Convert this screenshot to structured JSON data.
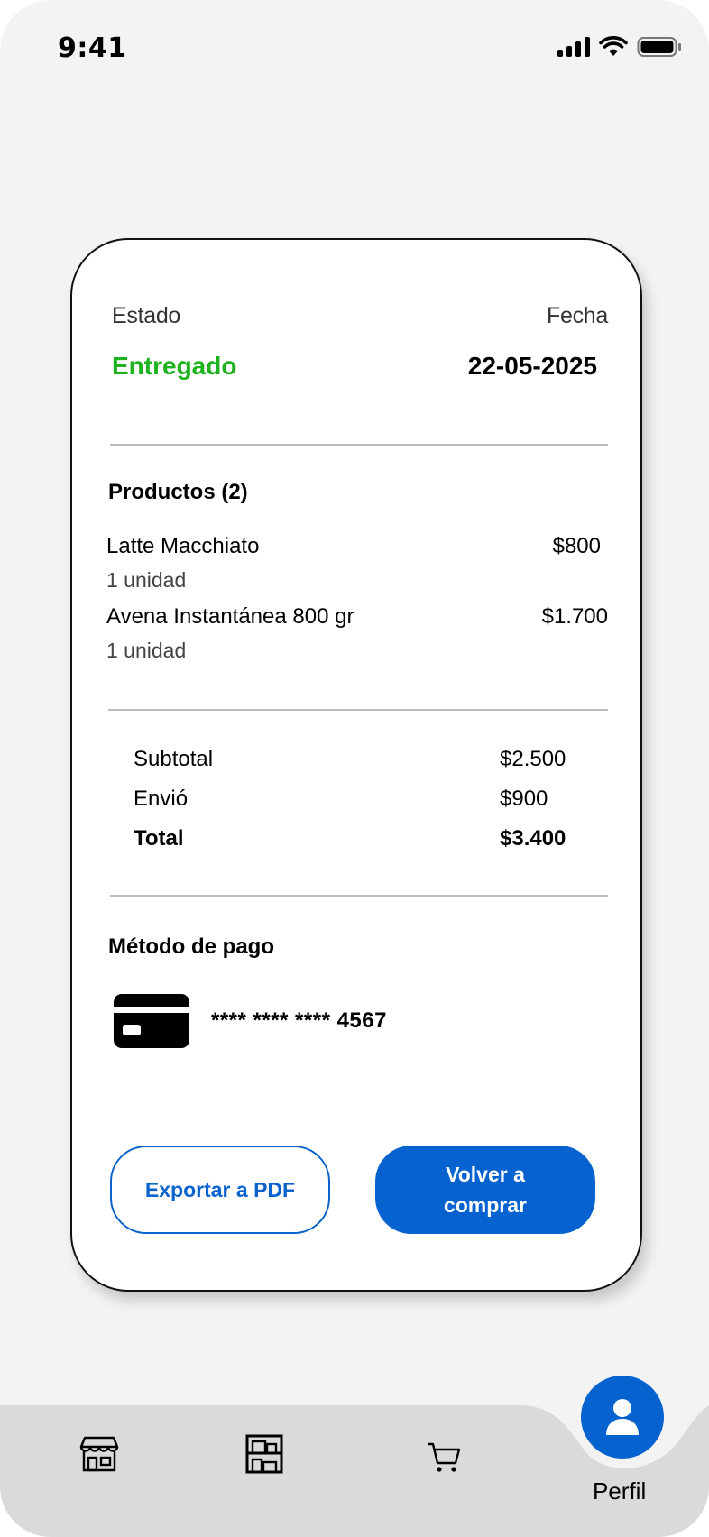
{
  "status_bar": {
    "time": "9:41"
  },
  "order": {
    "estado_label": "Estado",
    "estado_value": "Entregado",
    "fecha_label": "Fecha",
    "fecha_value": "22-05-2025",
    "status_color": "#1fb21f"
  },
  "productos": {
    "title": "Productos (2)",
    "items": [
      {
        "name": "Latte Macchiato",
        "qty": "1 unidad",
        "price": "$800"
      },
      {
        "name": "Avena Instantánea 800 gr",
        "qty": "1 unidad",
        "price": "$1.700"
      }
    ]
  },
  "resumen": {
    "subtotal_label": "Subtotal",
    "subtotal_value": "$2.500",
    "envio_label": "Envió",
    "envio_value": "$900",
    "total_label": "Total",
    "total_value": "$3.400"
  },
  "pago": {
    "title": "Método de pago",
    "card_number": "**** **** **** 4567",
    "card_icon": "credit-card-icon"
  },
  "actions": {
    "export_label": "Exportar a PDF",
    "rebuy_label": "Volver a comprar",
    "accent_color": "#0662cf"
  },
  "nav": {
    "items": [
      {
        "icon": "store-icon"
      },
      {
        "icon": "shelves-icon"
      },
      {
        "icon": "cart-icon"
      },
      {
        "icon": "user-icon",
        "label": "Perfil",
        "active": true
      }
    ]
  }
}
